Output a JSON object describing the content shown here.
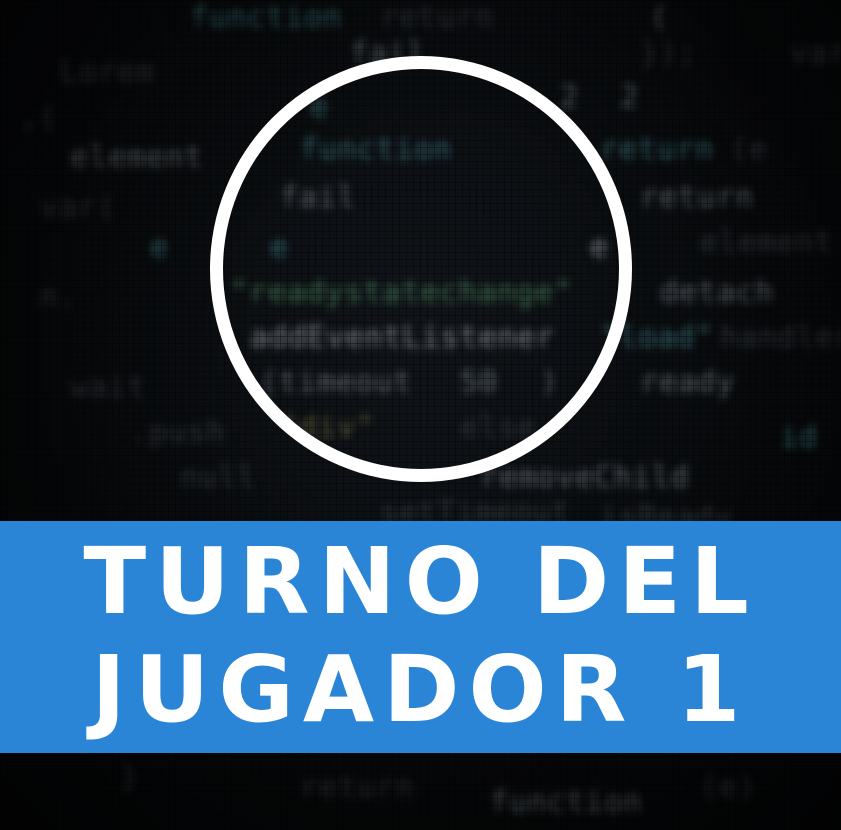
{
  "banner": {
    "line1": "TURNO DEL",
    "line2": "JUGADOR 1",
    "color": "#2a85d6",
    "text_color": "#ffffff"
  },
  "turn_indicator": {
    "icon": "ring-icon",
    "color": "#ffffff"
  },
  "background": {
    "icon": "blurred-code-background"
  }
}
